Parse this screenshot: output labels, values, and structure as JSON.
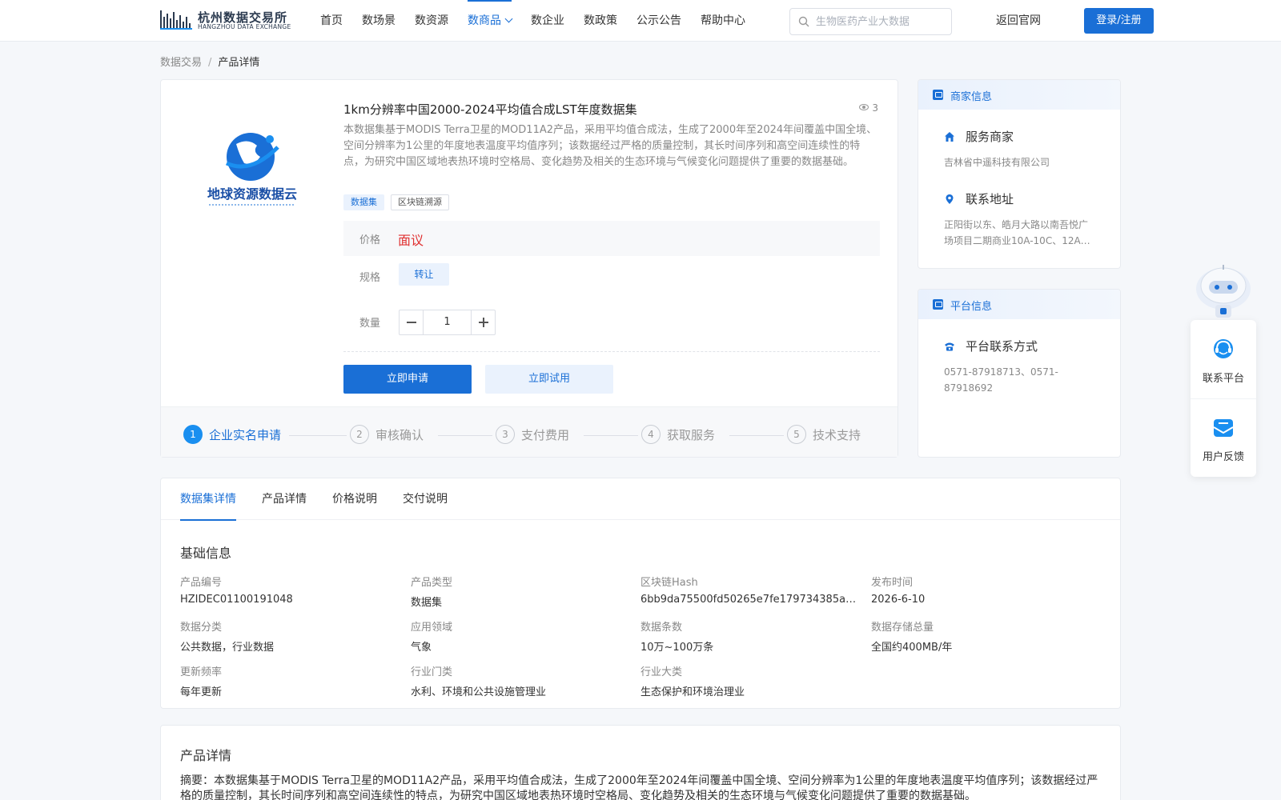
{
  "header": {
    "logo_cn": "杭州数据交易所",
    "logo_en": "HANGZHOU DATA EXCHANGE",
    "nav": [
      "首页",
      "数场景",
      "数资源",
      "数商品",
      "数企业",
      "数政策",
      "公示公告",
      "帮助中心"
    ],
    "active_nav": "数商品",
    "search_placeholder": "生物医药产业大数据",
    "return_label": "返回官网",
    "login_label": "登录/注册"
  },
  "breadcrumb": {
    "root": "数据交易",
    "sep": "/",
    "current": "产品详情"
  },
  "product": {
    "logo_text": "地球资源数据云",
    "title": "1km分辨率中国2000-2024平均值合成LST年度数据集",
    "views": "3",
    "description": "本数据集基于MODIS Terra卫星的MOD11A2产品，采用平均值合成法，生成了2000年至2024年间覆盖中国全境、空间分辨率为1公里的年度地表温度平均值序列；该数据经过严格的质量控制，其长时间序列和高空间连续性的特点，为研究中国区域地表热环境时空格局、变化趋势及相关的生态环境与气候变化问题提供了重要的数据基础。",
    "tags": [
      "数据集",
      "区块链溯源"
    ],
    "price_label": "价格",
    "price_value": "面议",
    "spec_label": "规格",
    "spec_value": "转让",
    "qty_label": "数量",
    "qty_value": "1",
    "apply_label": "立即申请",
    "trial_label": "立即试用"
  },
  "steps": [
    {
      "num": "1",
      "label": "企业实名申请"
    },
    {
      "num": "2",
      "label": "审核确认"
    },
    {
      "num": "3",
      "label": "支付费用"
    },
    {
      "num": "4",
      "label": "获取服务"
    },
    {
      "num": "5",
      "label": "技术支持"
    }
  ],
  "merchant": {
    "head": "商家信息",
    "service_title": "服务商家",
    "service_value": "吉林省中遥科技有限公司",
    "address_title": "联系地址",
    "address_value": "正阳街以东、皓月大路以南吾悦广场项目二期商业10A-10C、12A…"
  },
  "platform": {
    "head": "平台信息",
    "contact_title": "平台联系方式",
    "contact_value": "0571-87918713、0571-87918692"
  },
  "floating": {
    "contact_label": "联系平台",
    "feedback_label": "用户反馈"
  },
  "tabs": [
    "数据集详情",
    "产品详情",
    "价格说明",
    "交付说明"
  ],
  "basic": {
    "title": "基础信息",
    "fields": [
      {
        "label": "产品编号",
        "value": "HZIDEC01100191048"
      },
      {
        "label": "产品类型",
        "value": "数据集"
      },
      {
        "label": "区块链Hash",
        "value": "6bb9da75500fd50265e7fe179734385a01…"
      },
      {
        "label": "发布时间",
        "value": "2026-6-10"
      },
      {
        "label": "数据分类",
        "value": "公共数据，行业数据"
      },
      {
        "label": "应用领域",
        "value": "气象"
      },
      {
        "label": "数据条数",
        "value": "10万~100万条"
      },
      {
        "label": "数据存储总量",
        "value": "全国约400MB/年"
      },
      {
        "label": "更新频率",
        "value": "每年更新"
      },
      {
        "label": "行业门类",
        "value": "水利、环境和公共设施管理业"
      },
      {
        "label": "行业大类",
        "value": "生态保护和环境治理业"
      }
    ]
  },
  "summary": {
    "title": "产品详情",
    "text": "摘要：本数据集基于MODIS Terra卫星的MOD11A2产品，采用平均值合成法，生成了2000年至2024年间覆盖中国全境、空间分辨率为1公里的年度地表温度平均值序列；该数据经过严格的质量控制，其长时间序列和高空间连续性的特点，为研究中国区域地表热环境时空格局、变化趋势及相关的生态环境与气候变化问题提供了重要的数据基础。"
  },
  "colors": {
    "primary": "#1a6fd6",
    "price": "#e03131",
    "step_active": "#1a8ff0"
  }
}
